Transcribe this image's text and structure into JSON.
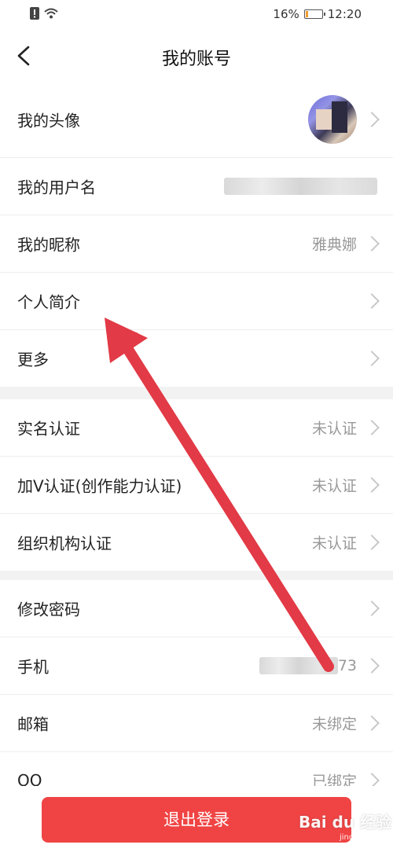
{
  "status": {
    "battery_pct": "16%",
    "time": "12:20",
    "battery_fill": 0.16
  },
  "nav": {
    "title": "我的账号"
  },
  "sections": [
    {
      "rows": [
        {
          "label": "我的头像",
          "value": ""
        },
        {
          "label": "我的用户名",
          "value": ""
        },
        {
          "label": "我的昵称",
          "value": "雅典娜"
        },
        {
          "label": "个人简介",
          "value": ""
        },
        {
          "label": "更多",
          "value": ""
        }
      ]
    },
    {
      "rows": [
        {
          "label": "实名认证",
          "value": "未认证"
        },
        {
          "label": "加V认证(创作能力认证)",
          "value": "未认证"
        },
        {
          "label": "组织机构认证",
          "value": "未认证"
        }
      ]
    },
    {
      "rows": [
        {
          "label": "修改密码",
          "value": ""
        },
        {
          "label": "手机",
          "value": "73"
        },
        {
          "label": "邮箱",
          "value": "未绑定"
        },
        {
          "label": "QQ",
          "value": "已绑定"
        }
      ]
    }
  ],
  "logout_label": "退出登录",
  "watermark": {
    "brand": "Bai du 经验",
    "url": "jingyan.baidu.com"
  },
  "colors": {
    "accent": "#f04444",
    "arrow": "#e23a46"
  }
}
